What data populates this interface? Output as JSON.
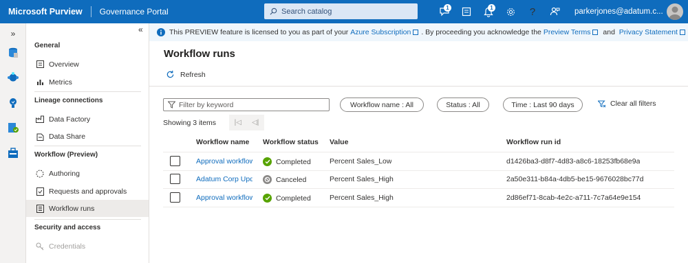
{
  "header": {
    "brand": "Microsoft Purview",
    "portal": "Governance Portal",
    "search_placeholder": "Search catalog",
    "notification_badges": [
      "1",
      "1"
    ],
    "user": "parkerjones@adatum.c..."
  },
  "sidenav": {
    "sections": [
      {
        "title": "General",
        "items": [
          {
            "label": "Overview",
            "icon": "overview-icon"
          },
          {
            "label": "Metrics",
            "icon": "metrics-icon"
          }
        ]
      },
      {
        "title": "Lineage connections",
        "items": [
          {
            "label": "Data Factory",
            "icon": "factory-icon"
          },
          {
            "label": "Data Share",
            "icon": "share-icon"
          }
        ]
      },
      {
        "title": "Workflow (Preview)",
        "items": [
          {
            "label": "Authoring",
            "icon": "authoring-icon"
          },
          {
            "label": "Requests and approvals",
            "icon": "requests-icon"
          },
          {
            "label": "Workflow runs",
            "icon": "runs-icon",
            "active": true
          }
        ]
      },
      {
        "title": "Security and access",
        "items": [
          {
            "label": "Credentials",
            "icon": "credentials-icon",
            "disabled": true
          }
        ]
      }
    ]
  },
  "banner": {
    "text1": "This PREVIEW feature is licensed to you as part of your",
    "link1": "Azure Subscription",
    "text2": ". By proceeding you acknowledge the",
    "link2": "Preview Terms",
    "text3": "and",
    "link3": "Privacy Statement"
  },
  "page": {
    "title": "Workflow runs",
    "refresh_label": "Refresh",
    "filter_placeholder": "Filter by keyword",
    "pills": [
      "Workflow name : All",
      "Status : All",
      "Time : Last 90 days"
    ],
    "clear_filters": "Clear all filters",
    "showing": "Showing 3 items"
  },
  "table": {
    "columns": [
      "Workflow name",
      "Workflow status",
      "Value",
      "Workflow run id"
    ],
    "rows": [
      {
        "name": "Approval workflow",
        "status": "Completed",
        "status_kind": "completed",
        "value": "Percent Sales_Low",
        "run_id": "d1426ba3-d8f7-4d83-a8c6-18253fb68e9a"
      },
      {
        "name": "Adatum Corp Update",
        "status": "Canceled",
        "status_kind": "canceled",
        "value": "Percent Sales_High",
        "run_id": "2a50e311-b84a-4db5-be15-9676028bc77d"
      },
      {
        "name": "Approval workflow",
        "status": "Completed",
        "status_kind": "completed",
        "value": "Percent Sales_High",
        "run_id": "2d86ef71-8cab-4e2c-a711-7c7a64e9e154"
      }
    ]
  },
  "colors": {
    "brand": "#0f6cbd",
    "completed": "#57a300",
    "canceled": "#8a8886"
  }
}
